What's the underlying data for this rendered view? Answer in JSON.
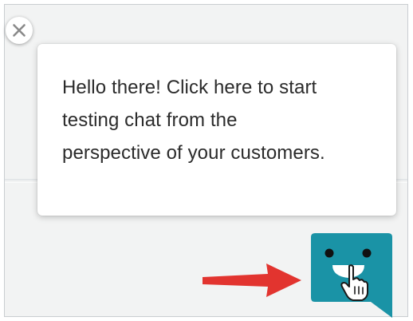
{
  "tooltip": {
    "message_line_1": "Hello there! Click here to start",
    "message_line_2": "testing chat from the",
    "message_line_3": "perspective of your customers."
  },
  "icons": {
    "close": "close-icon",
    "pointer_arrow": "red-arrow-icon",
    "chat_launcher": "chat-bubble-face-icon",
    "cursor": "hand-cursor-icon"
  },
  "colors": {
    "launcher_teal": "#1a93a6",
    "arrow_red": "#e2342f",
    "tooltip_background": "#ffffff",
    "page_background": "#f2f3f3"
  }
}
